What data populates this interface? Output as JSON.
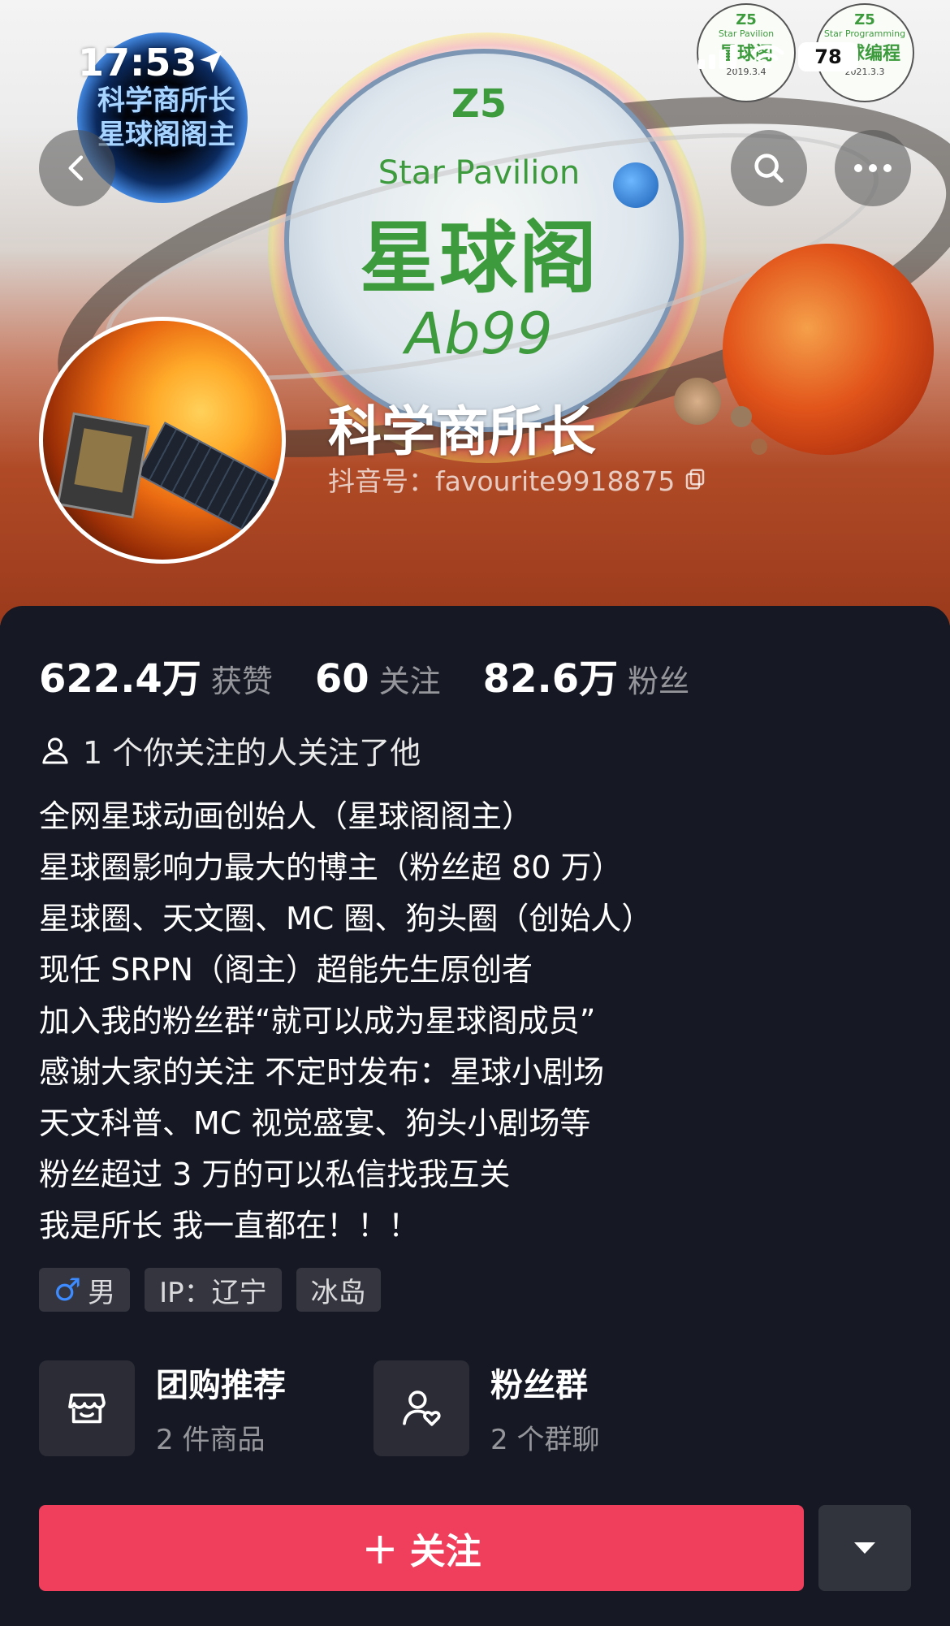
{
  "status_bar": {
    "time": "17:53",
    "battery": "78"
  },
  "banner": {
    "top_left_text_line1": "科学商所长",
    "top_left_text_line2": "星球阁阁主",
    "logo_mark": "Z5",
    "logo_en": "Star Pavilion",
    "logo_cn": "星球阁",
    "logo_signature": "Ab99",
    "badge1": {
      "mark": "Z5",
      "title": "Star Pavilion",
      "cn": "星球阁",
      "date": "2019.3.4"
    },
    "badge2": {
      "mark": "Z5",
      "title": "Star Programming",
      "cn": "星球编程",
      "date": "2021.3.3"
    }
  },
  "profile": {
    "nickname": "科学商所长",
    "douyin_id": "抖音号：favourite9918875"
  },
  "stats": [
    {
      "value": "622.4万",
      "label": "获赞"
    },
    {
      "value": "60",
      "label": "关注"
    },
    {
      "value": "82.6万",
      "label": "粉丝"
    }
  ],
  "mutual_follow": "1 个你关注的人关注了他",
  "bio_lines": [
    "全网星球动画创始人（星球阁阁主）",
    "星球圈影响力最大的博主（粉丝超 80 万）",
    "星球圈、天文圈、MC 圈、狗头圈（创始人）",
    "现任 SRPN（阁主）超能先生原创者",
    "加入我的粉丝群“就可以成为星球阁成员”",
    "感谢大家的关注 不定时发布：星球小剧场",
    "天文科普、MC 视觉盛宴、狗头小剧场等",
    "粉丝超过 3 万的可以私信找我互关",
    "我是所长 我一直都在！！！"
  ],
  "tags": {
    "gender_symbol": "♂",
    "gender": "男",
    "ip": "IP：辽宁",
    "location": "冰岛"
  },
  "entries": [
    {
      "title": "团购推荐",
      "sub": "2 件商品"
    },
    {
      "title": "粉丝群",
      "sub": "2 个群聊"
    }
  ],
  "follow_button": {
    "plus": "+",
    "label": "关注"
  },
  "colors": {
    "follow": "#ef3f5c",
    "background": "#161823",
    "gender_icon": "#3d8bff"
  }
}
